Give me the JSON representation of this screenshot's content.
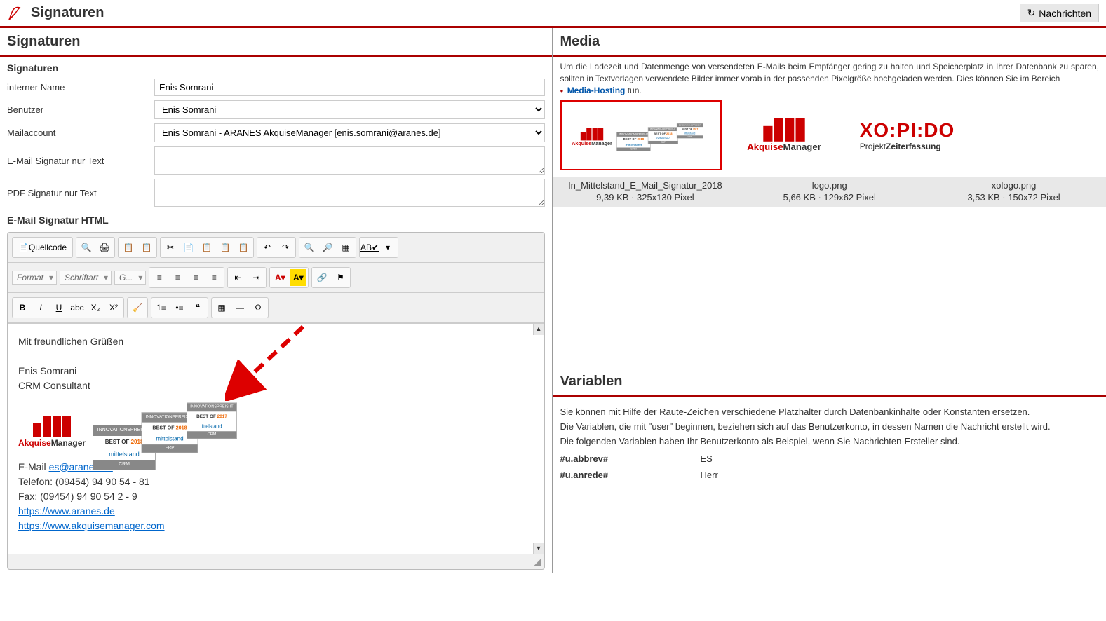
{
  "header": {
    "title": "Signaturen",
    "refresh_label": "Nachrichten"
  },
  "left": {
    "panel_title": "Signaturen",
    "section_title": "Signaturen",
    "fields": {
      "interner_name_label": "interner Name",
      "interner_name_value": "Enis Somrani",
      "benutzer_label": "Benutzer",
      "benutzer_value": "Enis Somrani",
      "mailaccount_label": "Mailaccount",
      "mailaccount_value": "Enis Somrani - ARANES AkquiseManager [enis.somrani@aranes.de]",
      "text_sig_label": "E-Mail Signatur nur Text",
      "text_sig_value": "",
      "pdf_sig_label": "PDF Signatur nur Text",
      "pdf_sig_value": ""
    },
    "html_section_title": "E-Mail Signatur HTML",
    "editor": {
      "quellcode": "Quellcode",
      "format": "Format",
      "schriftart": "Schriftart",
      "groesse": "G...",
      "content": {
        "greeting": "Mit freundlichen Grüßen",
        "name": "Enis Somrani",
        "role": "CRM Consultant",
        "logo_text_1": "Akquise",
        "logo_text_2": "Manager",
        "badge1_header": "INNOVATIONSPREIS-IT",
        "badge1_best": "BEST OF",
        "badge1_year": "2018",
        "badge1_mid": "mittelstand",
        "badge1_footer": "CRM",
        "badge2_header": "INNOVATIONSPREIS-IT",
        "badge2_best": "BEST OF",
        "badge2_year": "2018",
        "badge2_mid": "mittelstand",
        "badge2_footer": "ERP",
        "badge3_header": "INNOVATIONSPREIS-IT",
        "badge3_best": "BEST OF",
        "badge3_year": "2017",
        "badge3_mid": "ittelstand",
        "badge3_footer": "CRM",
        "email_label": "E-Mail ",
        "email_link": "es@aranes.de",
        "phone": "Telefon: (09454) 94 90 54 - 81",
        "fax": "Fax: (09454) 94 90 54 2 - 9",
        "url1": "https://www.aranes.de",
        "url2": "https://www.akquisemanager.com"
      }
    }
  },
  "right": {
    "media_title": "Media",
    "media_desc_1": "Um die Ladezeit und Datenmenge von versendeten E-Mails beim Empfänger gering zu halten und Speicherplatz in Ihrer Datenbank zu sparen, sollten in Textvorlagen verwendete Bilder immer vorab in der passenden Pixelgröße hochgeladen werden. Dies können Sie im Bereich ",
    "media_desc_link": "Media-Hosting",
    "media_desc_2": " tun.",
    "thumbs": {
      "am_text_1": "Akquise",
      "am_text_2": "Manager",
      "xo_big": "XO:PI:DO",
      "xo_sub_1": "Projekt",
      "xo_sub_2": "Zeiterfassung"
    },
    "files": [
      {
        "name": "In_Mittelstand_E_Mail_Signatur_2018",
        "meta": "9,39 KB · 325x130 Pixel"
      },
      {
        "name": "logo.png",
        "meta": "5,66 KB · 129x62 Pixel"
      },
      {
        "name": "xologo.png",
        "meta": "3,53 KB · 150x72 Pixel"
      }
    ],
    "variables_title": "Variablen",
    "variables_desc_1": "Sie können mit Hilfe der Raute-Zeichen verschiedene Platzhalter durch Datenbankinhalte oder Konstanten ersetzen.",
    "variables_desc_2": "Die Variablen, die mit \"user\" beginnen, beziehen sich auf das Benutzerkonto, in dessen Namen die Nachricht erstellt wird.",
    "variables_desc_3": "Die folgenden Variablen haben Ihr Benutzerkonto als Beispiel, wenn Sie Nachrichten-Ersteller sind.",
    "vars": [
      {
        "key": "#u.abbrev#",
        "val": "ES"
      },
      {
        "key": "#u.anrede#",
        "val": "Herr"
      }
    ]
  }
}
